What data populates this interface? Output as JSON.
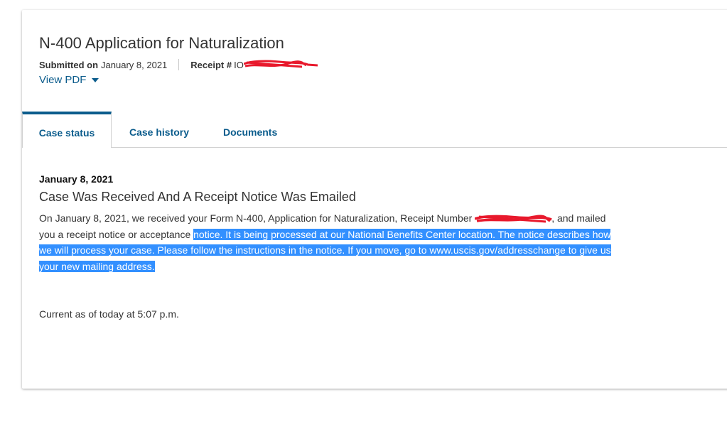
{
  "case": {
    "title": "N-400 Application for Naturalization",
    "submitted_label": "Submitted on",
    "submitted_date": "January 8, 2021",
    "receipt_label": "Receipt #",
    "receipt_visible_prefix": "IO",
    "view_pdf_label": "View PDF"
  },
  "tabs": [
    {
      "label": "Case status",
      "active": true
    },
    {
      "label": "Case history",
      "active": false
    },
    {
      "label": "Documents",
      "active": false
    }
  ],
  "status": {
    "date": "January 8, 2021",
    "title": "Case Was Received And A Receipt Notice Was Emailed",
    "body_part1": "On January 8, 2021, we received your Form N-400, Application for Naturalization, Receipt Number ",
    "body_part2": ", and mailed you a receipt notice or acceptance ",
    "body_selected": "notice. It is being processed at our National Benefits Center location. The notice describes how we will process your case. Please follow the instructions in the notice. If you move, go to www.uscis.gov/addresschange to give us your new mailing address."
  },
  "footer": {
    "current_as_of": "Current as of today at 5:07 p.m."
  },
  "colors": {
    "link": "#0b5c8c",
    "selection": "#3390ff",
    "redaction": "#e8192c"
  }
}
